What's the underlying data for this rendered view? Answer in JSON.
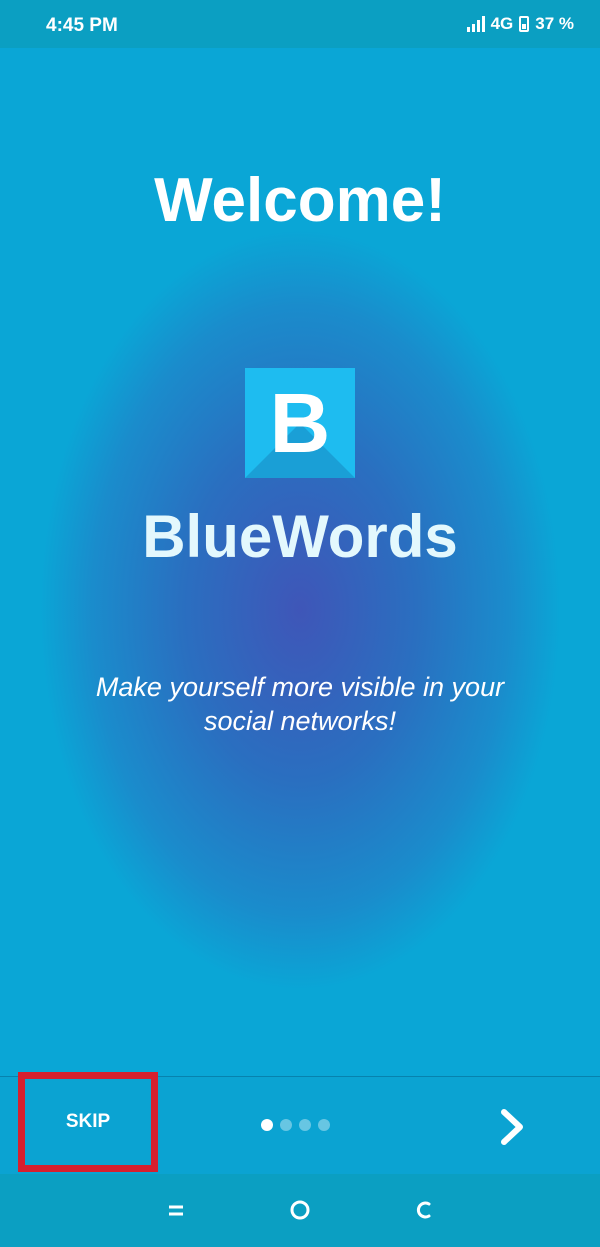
{
  "status_bar": {
    "time": "4:45 PM",
    "network": "4G",
    "battery": "37 %"
  },
  "welcome": {
    "title": "Welcome!",
    "logo_letter": "B",
    "app_name": "BlueWords",
    "tagline": "Make yourself more visible in your social networks!"
  },
  "onboarding": {
    "skip_label": "SKIP",
    "page_count": 4,
    "current_page": 1
  },
  "icons": {
    "next": "chevron-right-icon",
    "nav_recents": "recents-icon",
    "nav_home": "home-icon",
    "nav_back": "back-icon"
  },
  "colors": {
    "status_bar": "#0b9fc2",
    "logo_bg": "#1ebcf0",
    "highlight": "#d6202e"
  }
}
